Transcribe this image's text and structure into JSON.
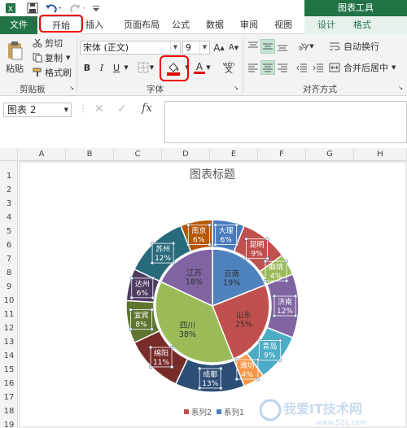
{
  "context_group": "图表工具",
  "tabs": {
    "file": "文件",
    "home": "开始",
    "insert": "插入",
    "page_layout": "页面布局",
    "formulas": "公式",
    "data": "数据",
    "review": "审阅",
    "view": "视图",
    "design": "设计",
    "format": "格式"
  },
  "clipboard": {
    "paste": "粘贴",
    "cut": "剪切",
    "copy": "复制",
    "format_painter": "格式刷",
    "group_label": "剪贴板"
  },
  "font": {
    "name": "宋体 (正文)",
    "size": "9",
    "bold": "B",
    "italic": "I",
    "underline": "U",
    "grow": "A",
    "shrink": "A",
    "wen": "wén",
    "group_label": "字体"
  },
  "alignment": {
    "wrap_text": "自动换行",
    "merge_center": "合并后居中",
    "group_label": "对齐方式"
  },
  "formula_bar": {
    "name_box": "图表 2",
    "fx": "fx"
  },
  "columns": [
    "A",
    "B",
    "C",
    "D",
    "E",
    "F",
    "G",
    "H"
  ],
  "rows": [
    "1",
    "2",
    "3",
    "4",
    "5",
    "6",
    "7",
    "8",
    "9",
    "10",
    "11",
    "12",
    "13",
    "14",
    "15",
    "16",
    "17",
    "18",
    "19"
  ],
  "colors": {
    "excel_green": "#217346",
    "highlight_red": "#e00000"
  },
  "chart_data": {
    "type": "pie",
    "title": "图表标题",
    "series": [
      {
        "name": "系列2",
        "ring": "outer",
        "categories": [
          "大理",
          "昆明",
          "曲靖",
          "济南",
          "青岛",
          "潍坊",
          "成都",
          "绵阳",
          "宜宾",
          "达州",
          "苏州",
          "南京"
        ],
        "display_labels": [
          "大理",
          "昆明",
          "曲靖",
          "济南",
          "青岛",
          "潍坊",
          "成都",
          "绵阳",
          "宜宾",
          "达州",
          "苏州",
          "南京"
        ],
        "values": [
          6,
          9,
          4,
          12,
          9,
          4,
          13,
          11,
          8,
          6,
          12,
          6
        ],
        "value_labels": [
          "6%",
          "9%",
          "4%",
          "12%",
          "9%",
          "4%",
          "13%",
          "11%",
          "8%",
          "6%",
          "12%",
          "6%"
        ],
        "colors": [
          "#4a7bbd",
          "#c0504d",
          "#9bbb59",
          "#8064a2",
          "#4bacc6",
          "#f79646",
          "#2c4d75",
          "#772c2a",
          "#5f7530",
          "#4d3b62",
          "#276a7c",
          "#b65708"
        ]
      },
      {
        "name": "系列1",
        "ring": "inner",
        "categories": [
          "云南",
          "山东",
          "四川",
          "江苏"
        ],
        "display_labels": [
          "云南",
          "山东",
          "四川",
          "江苏"
        ],
        "values": [
          19,
          25,
          38,
          18
        ],
        "value_labels": [
          "19%",
          "25%",
          "38%",
          "18%"
        ],
        "colors": [
          "#4f81bd",
          "#c0504d",
          "#9bbb59",
          "#8064a2"
        ]
      }
    ],
    "legend": [
      "系列2",
      "系列1"
    ],
    "legend_position": "bottom"
  },
  "watermark": {
    "text": "我爱IT技术网",
    "url": "www.52ij.com"
  }
}
